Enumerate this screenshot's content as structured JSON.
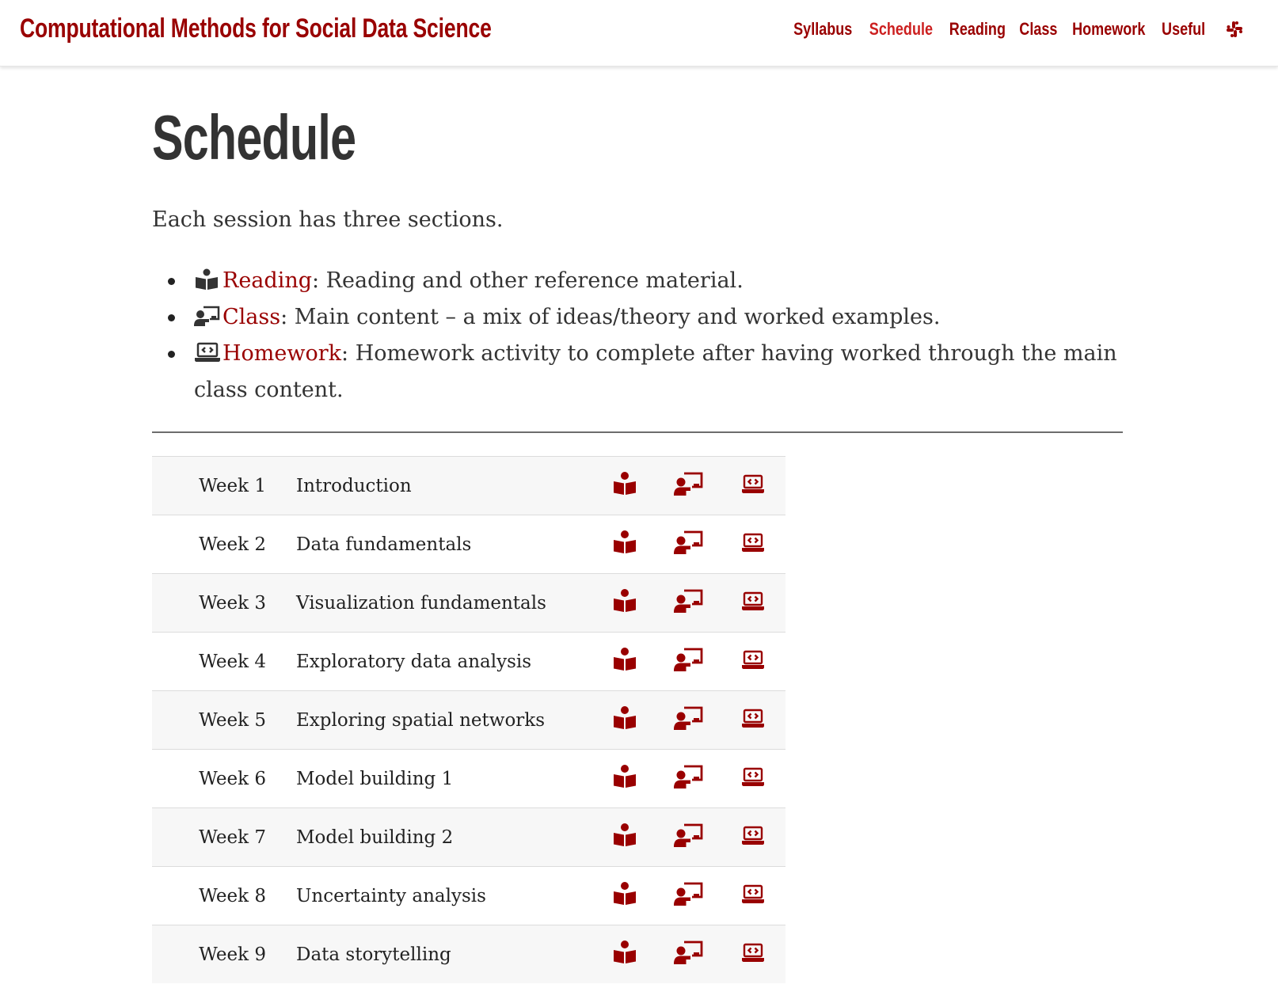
{
  "colors": {
    "accent": "#990000",
    "active_nav": "#cc1f1f",
    "text": "#333333",
    "row_stripe": "#f7f7f7"
  },
  "navbar": {
    "brand": "Computational Methods for Social Data Science",
    "links": [
      {
        "label": "Syllabus",
        "active": false
      },
      {
        "label": "Schedule",
        "active": true
      },
      {
        "label": "Reading",
        "active": false
      },
      {
        "label": "Class",
        "active": false
      },
      {
        "label": "Homework",
        "active": false
      },
      {
        "label": "Useful",
        "active": false
      }
    ],
    "extra_icon": "slack-icon"
  },
  "page": {
    "title": "Schedule",
    "intro": "Each session has three sections.",
    "sections": [
      {
        "icon": "book-reader-icon",
        "term": "Reading",
        "description": ": Reading and other reference material."
      },
      {
        "icon": "chalkboard-teacher-icon",
        "term": "Class",
        "description": ": Main content – a mix of ideas/theory and worked examples."
      },
      {
        "icon": "laptop-code-icon",
        "term": "Homework",
        "description": ": Homework activity to complete after having worked through the main class content."
      }
    ]
  },
  "schedule": {
    "columns_icons": [
      "book-reader-icon",
      "chalkboard-teacher-icon",
      "laptop-code-icon"
    ],
    "rows": [
      {
        "week": "Week 1",
        "topic": "Introduction"
      },
      {
        "week": "Week 2",
        "topic": "Data fundamentals"
      },
      {
        "week": "Week 3",
        "topic": "Visualization fundamentals"
      },
      {
        "week": "Week 4",
        "topic": "Exploratory data analysis"
      },
      {
        "week": "Week 5",
        "topic": "Exploring spatial networks"
      },
      {
        "week": "Week 6",
        "topic": "Model building 1"
      },
      {
        "week": "Week 7",
        "topic": "Model building 2"
      },
      {
        "week": "Week 8",
        "topic": "Uncertainty analysis"
      },
      {
        "week": "Week 9",
        "topic": "Data storytelling"
      }
    ]
  }
}
